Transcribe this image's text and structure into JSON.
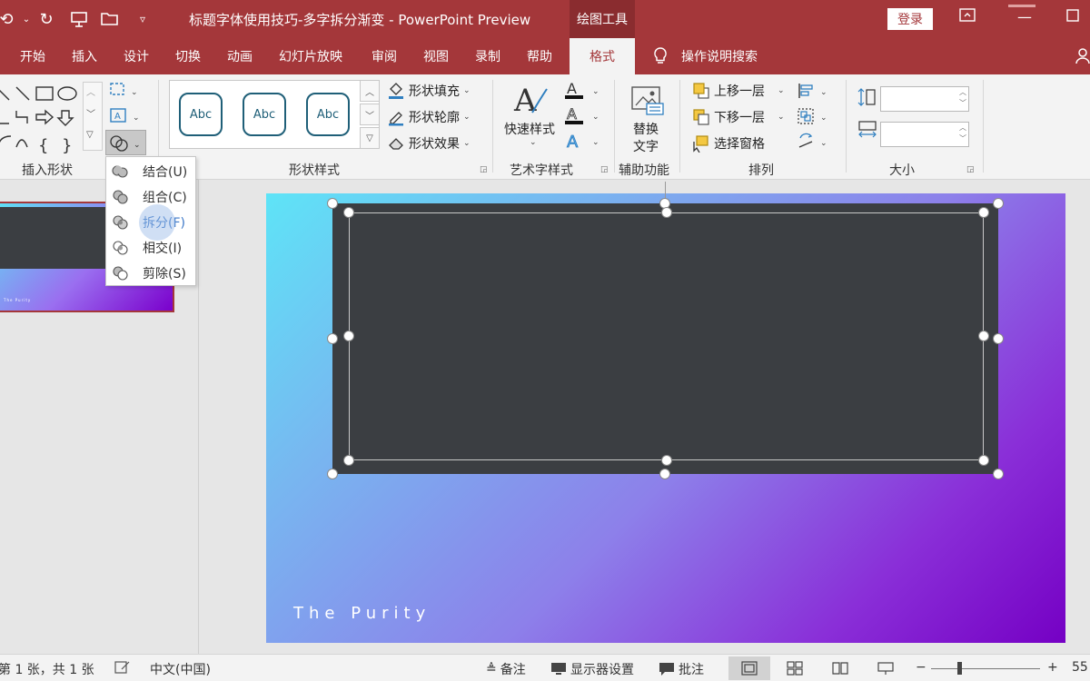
{
  "titlebar": {
    "doc_title": "标题字体使用技巧-多字拆分渐变  -  PowerPoint Preview",
    "context_tab": "绘图工具",
    "login": "登录",
    "qa_icons": [
      "undo-icon",
      "redo-icon",
      "present-icon",
      "open-icon",
      "customize-icon"
    ]
  },
  "tabs": [
    {
      "label": "开始"
    },
    {
      "label": "插入"
    },
    {
      "label": "设计"
    },
    {
      "label": "切换"
    },
    {
      "label": "动画"
    },
    {
      "label": "幻灯片放映"
    },
    {
      "label": "审阅"
    },
    {
      "label": "视图"
    },
    {
      "label": "录制"
    },
    {
      "label": "帮助"
    },
    {
      "label": "格式"
    },
    {
      "label": "操作说明搜索"
    }
  ],
  "ribbon": {
    "insert_shapes": {
      "label": "插入形状"
    },
    "shape_styles": {
      "label": "形状样式",
      "presets": [
        "Abc",
        "Abc",
        "Abc"
      ],
      "fill": "形状填充",
      "outline": "形状轮廓",
      "effects": "形状效果"
    },
    "wordart": {
      "label": "艺术字样式",
      "quick_styles": "快速样式"
    },
    "accessibility": {
      "label": "辅助功能",
      "alt_text_1": "替换",
      "alt_text_2": "文字"
    },
    "arrange": {
      "label": "排列",
      "bring_forward": "上移一层",
      "send_backward": "下移一层",
      "selection_pane": "选择窗格"
    },
    "size": {
      "label": "大小",
      "height": "",
      "width": ""
    }
  },
  "merge_menu": {
    "items": [
      {
        "label": "结合(U)"
      },
      {
        "label": "组合(C)"
      },
      {
        "label": "拆分(F)"
      },
      {
        "label": "相交(I)"
      },
      {
        "label": "剪除(S)"
      }
    ],
    "highlighted": "拆分(F)"
  },
  "slide": {
    "text": "The Purity",
    "thumb_text": "The Purity"
  },
  "statusbar": {
    "slide_info": "第 1 张，共 1 张",
    "language": "中文(中国)",
    "notes": "备注",
    "display_settings": "显示器设置",
    "comments": "批注",
    "zoom": "55"
  },
  "colors": {
    "accent": "#a4373a",
    "shape_fill": "#3b3e42",
    "gradient_start": "#5ee4f7",
    "gradient_end": "#7500c4"
  }
}
